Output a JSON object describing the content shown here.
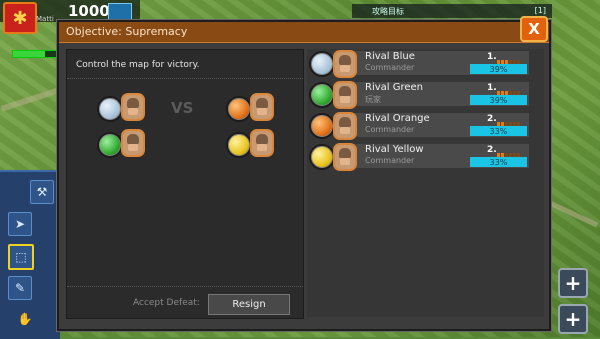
{
  "hud": {
    "money": "1000",
    "player_name": "Matti",
    "top_label": "攻略目标",
    "top_count": "[1]"
  },
  "dialog": {
    "title": "Objective: Supremacy",
    "description": "Control the map for victory.",
    "vs_text": "VS",
    "accept_defeat_label": "Accept Defeat:",
    "resign_label": "Resign",
    "close_icon": "close-x-icon"
  },
  "teams": {
    "left": [
      {
        "color": "#a9c3d8",
        "name": "Rival Blue"
      },
      {
        "color": "#2fa82f",
        "name": "Rival Green"
      }
    ],
    "right": [
      {
        "color": "#e07018",
        "name": "Rival Orange"
      },
      {
        "color": "#e8c21c",
        "name": "Rival Yellow"
      }
    ]
  },
  "players": [
    {
      "name": "Rival Blue",
      "role": "Commander",
      "color": "#a9c3d8",
      "rank": "1.",
      "pct": "39%"
    },
    {
      "name": "Rival Green",
      "role": "玩家",
      "color": "#2fa82f",
      "rank": "1.",
      "pct": "39%"
    },
    {
      "name": "Rival Orange",
      "role": "Commander",
      "color": "#e07018",
      "rank": "2.",
      "pct": "33%"
    },
    {
      "name": "Rival Yellow",
      "role": "Commander",
      "color": "#e8c21c",
      "rank": "2.",
      "pct": "33%"
    }
  ]
}
